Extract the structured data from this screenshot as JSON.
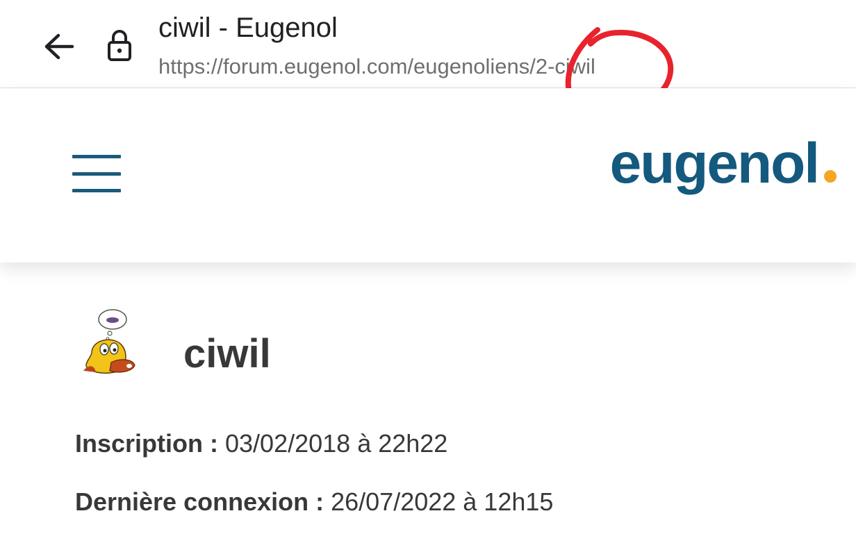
{
  "browser": {
    "page_title": "ciwil - Eugenol",
    "url": "https://forum.eugenol.com/eugenoliens/2-ciwil",
    "back_icon": "arrow-left-icon",
    "lock_icon": "lock-icon"
  },
  "site": {
    "logo_text": "eugenol",
    "menu_icon": "hamburger-menu-icon",
    "colors": {
      "brand": "#14597e",
      "accent": "#f5a623",
      "annotation": "#e8232d"
    }
  },
  "profile": {
    "username": "ciwil",
    "info": [
      {
        "label": "Inscription :",
        "value": "03/02/2018 à 22h22"
      },
      {
        "label": "Dernière connexion :",
        "value": "26/07/2022 à 12h15"
      }
    ]
  }
}
